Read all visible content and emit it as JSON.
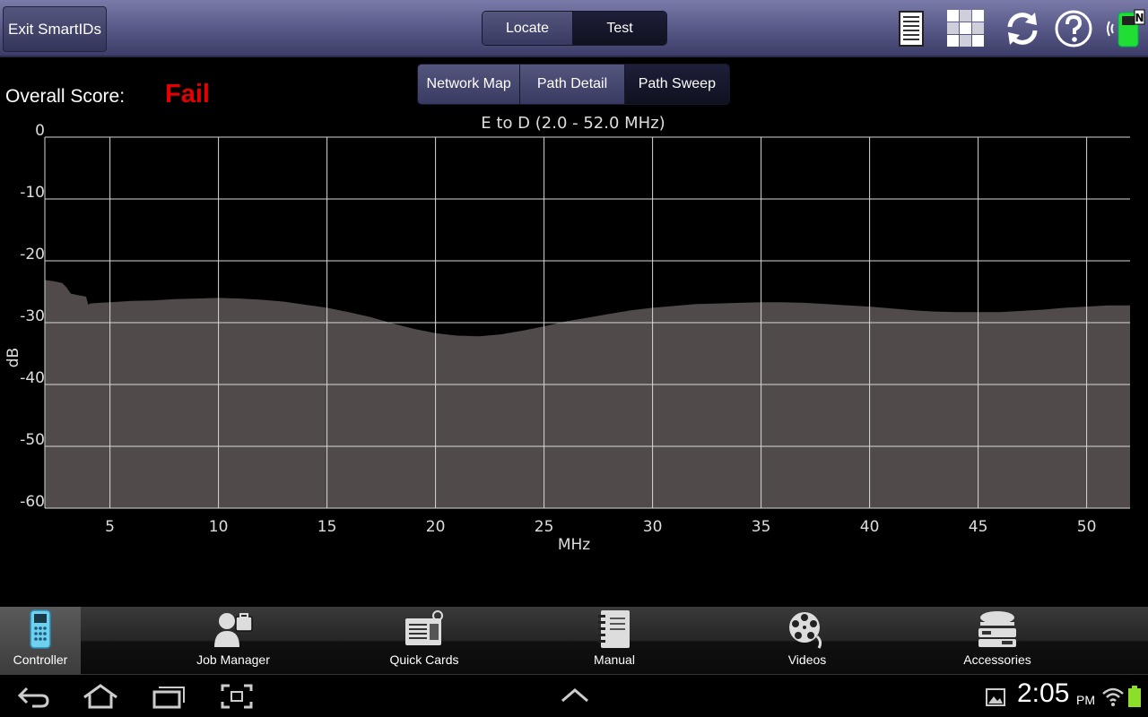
{
  "topbar": {
    "exit_label": "Exit SmartIDs",
    "mode_tabs": [
      {
        "label": "Locate",
        "selected": false
      },
      {
        "label": "Test",
        "selected": true
      }
    ],
    "icons": [
      "report-icon",
      "grid-icon",
      "refresh-icon",
      "help-icon",
      "meter-status-icon"
    ]
  },
  "view_tabs": [
    {
      "label": "Network Map",
      "selected": false
    },
    {
      "label": "Path Detail",
      "selected": false
    },
    {
      "label": "Path Sweep",
      "selected": true
    }
  ],
  "score": {
    "label": "Overall Score:",
    "value": "Fail",
    "color": "#e40000"
  },
  "chart_data": {
    "type": "area",
    "title": "E to D (2.0 - 52.0 MHz)",
    "xlabel": "MHz",
    "ylabel": "dB",
    "xlim": [
      2,
      52
    ],
    "ylim": [
      -60,
      0
    ],
    "xticks": [
      5,
      10,
      15,
      20,
      25,
      30,
      35,
      40,
      45,
      50
    ],
    "yticks": [
      0,
      -10,
      -20,
      -30,
      -40,
      -50,
      -60
    ],
    "grid": true,
    "fill_color": "#514a4a",
    "series": [
      {
        "x": [
          2.0,
          2.4,
          2.8,
          3.0,
          3.2,
          3.6,
          3.9,
          4.0,
          4.1,
          4.5,
          5,
          6,
          7,
          8,
          9,
          10,
          11,
          12,
          13,
          14,
          15,
          16,
          17,
          18,
          19,
          20,
          21,
          22,
          23,
          24,
          25,
          26,
          27,
          28,
          29,
          30,
          31,
          32,
          33,
          34,
          35,
          36,
          37,
          38,
          39,
          40,
          41,
          42,
          43,
          44,
          45,
          46,
          47,
          48,
          49,
          50,
          51,
          52
        ],
        "y": [
          -23.1,
          -23.3,
          -23.6,
          -24.3,
          -25.3,
          -25.6,
          -25.8,
          -27.1,
          -26.9,
          -26.8,
          -26.7,
          -26.5,
          -26.4,
          -26.2,
          -26.1,
          -26.0,
          -26.1,
          -26.3,
          -26.6,
          -27.1,
          -27.6,
          -28.3,
          -29.1,
          -30.1,
          -31.0,
          -31.7,
          -32.1,
          -32.2,
          -31.9,
          -31.3,
          -30.6,
          -29.8,
          -29.2,
          -28.6,
          -28.0,
          -27.6,
          -27.3,
          -27.0,
          -26.9,
          -26.8,
          -26.7,
          -26.7,
          -26.8,
          -27.0,
          -27.2,
          -27.4,
          -27.7,
          -28.0,
          -28.2,
          -28.3,
          -28.3,
          -28.3,
          -28.1,
          -27.9,
          -27.6,
          -27.4,
          -27.2,
          -27.2
        ]
      }
    ]
  },
  "bottom_nav": [
    {
      "label": "Controller",
      "active": true
    },
    {
      "label": "Job Manager",
      "active": false
    },
    {
      "label": "Quick Cards",
      "active": false
    },
    {
      "label": "Manual",
      "active": false
    },
    {
      "label": "Videos",
      "active": false
    },
    {
      "label": "Accessories",
      "active": false
    }
  ],
  "system_bar": {
    "time": "2:05",
    "ampm": "PM"
  }
}
